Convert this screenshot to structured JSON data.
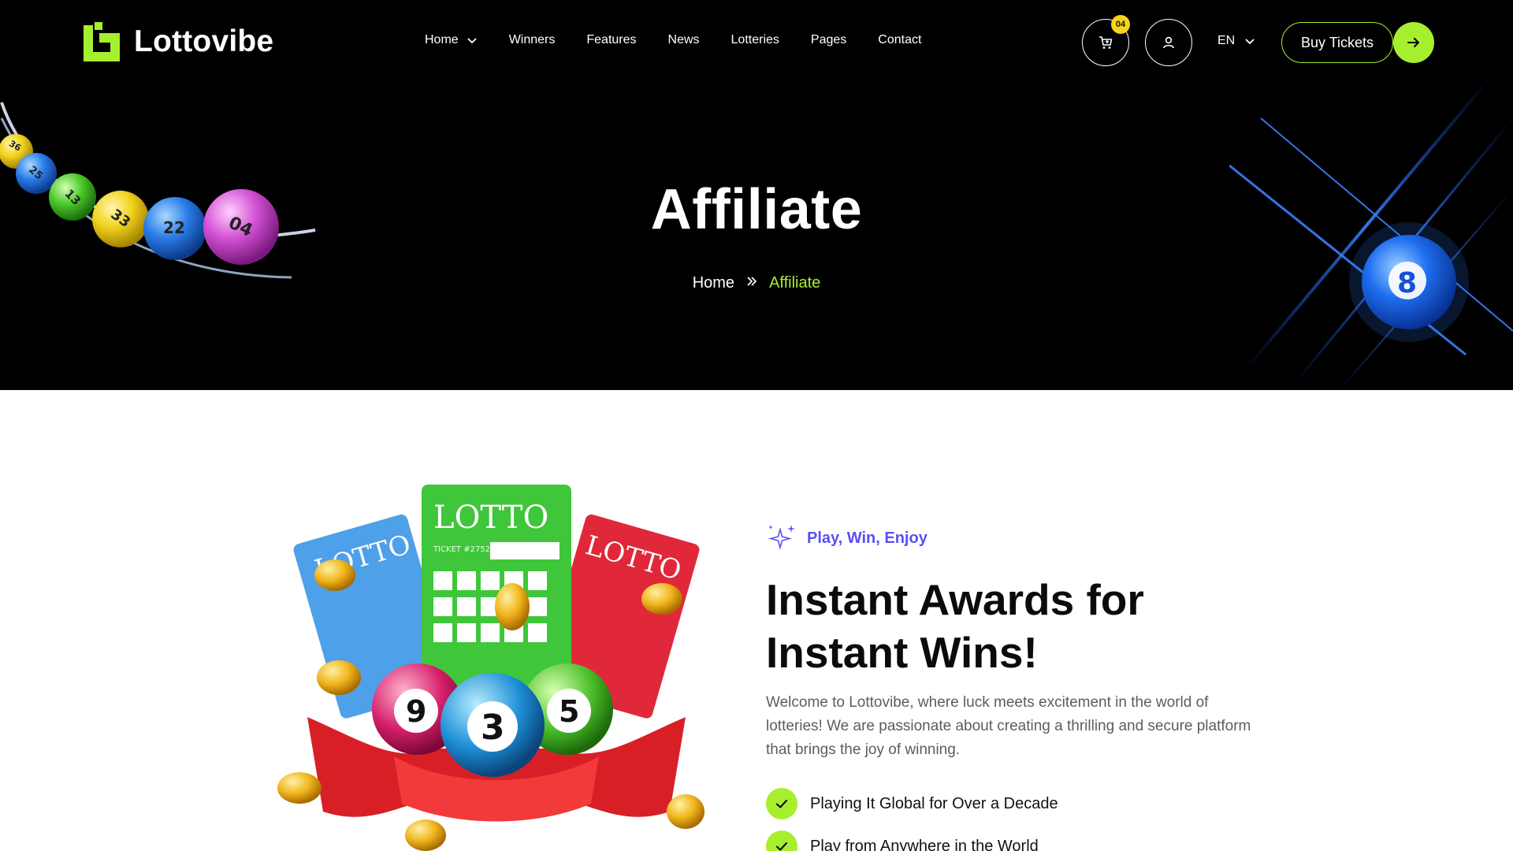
{
  "header": {
    "logo_text": "Lottovibe",
    "nav": [
      {
        "label": "Home",
        "has_dropdown": true
      },
      {
        "label": "Winners"
      },
      {
        "label": "Features"
      },
      {
        "label": "News"
      },
      {
        "label": "Lotteries"
      },
      {
        "label": "Pages"
      },
      {
        "label": "Contact"
      }
    ],
    "cart_count": "04",
    "language": "EN",
    "buy_label": "Buy Tickets"
  },
  "hero": {
    "title": "Affiliate",
    "breadcrumb": {
      "home": "Home",
      "current": "Affiliate"
    }
  },
  "about": {
    "eyebrow": "Play, Win, Enjoy",
    "heading": "Instant Awards for Instant Wins!",
    "description": "Welcome to Lottovibe, where luck meets excitement in the world of lotteries! We are passionate about creating a thrilling and secure platform that brings the joy of winning.",
    "features": [
      "Playing It Global for Over a Decade",
      "Play from Anywhere in the World"
    ]
  },
  "art": {
    "ticket_title": "LOTTO",
    "ticket_number": "TICKET #2752",
    "ball_numbers": [
      "9",
      "3",
      "5"
    ],
    "blue_orb_number": "8",
    "rail_ball_numbers": [
      "36",
      "25",
      "13",
      "33",
      "22",
      "04"
    ]
  },
  "colors": {
    "accent_green": "#a6ef2e",
    "eyebrow_purple": "#5b4ff5",
    "badge_yellow": "#f7d31b",
    "hero_bg": "#000000"
  },
  "icons": {
    "cart": "cart-icon",
    "user": "user-icon",
    "arrow": "arrow-right-icon",
    "check": "check-icon",
    "sparkle": "sparkle-icon"
  }
}
